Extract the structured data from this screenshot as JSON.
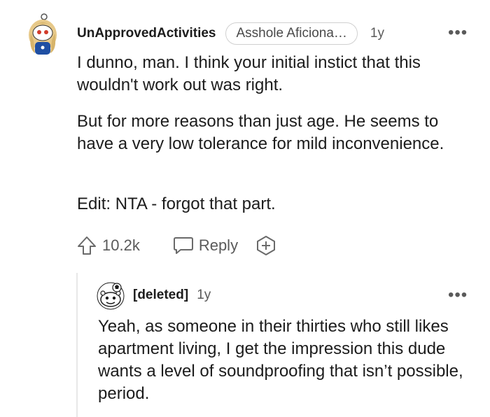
{
  "comment": {
    "username": "UnApprovedActivities",
    "flair": "Asshole Aficiona…",
    "age": "1y",
    "menu": "•••",
    "paragraphs": [
      "I dunno, man. I think your initial instict that this wouldn't work out was right.",
      "But for more reasons than just age. He seems to have a very low tolerance for mild inconvenience.",
      "Edit: NTA - forgot that part."
    ],
    "actions": {
      "upvote_icon": "upvote-arrow-icon",
      "score": "10.2k",
      "reply_icon": "speech-bubble-icon",
      "reply_label": "Reply",
      "award_icon": "award-plus-icon"
    }
  },
  "reply": {
    "username": "[deleted]",
    "age": "1y",
    "menu": "•••",
    "text": "Yeah, as someone in their thirties who still likes apartment living, I get the impression this dude wants a level of soundproofing that isn’t possible, period."
  },
  "colors": {
    "text": "#1c1c1c",
    "meta": "#5a5a5a",
    "border": "#d0d0d0",
    "avatar_blue": "#1f4fa3",
    "avatar_hair": "#e7c98a"
  }
}
